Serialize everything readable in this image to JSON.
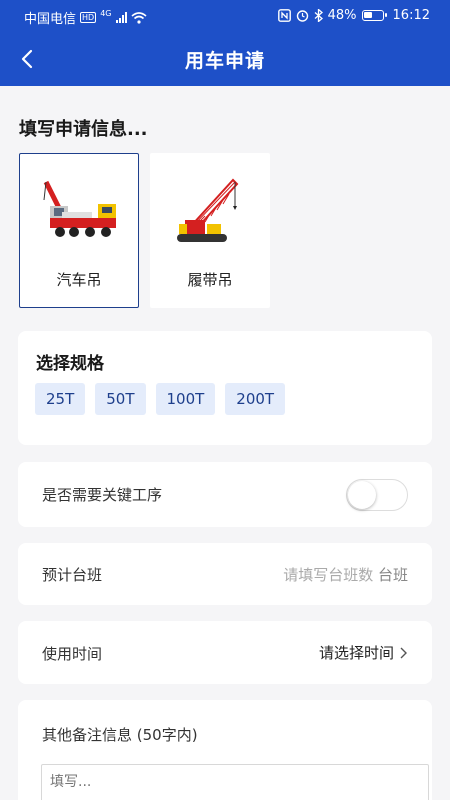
{
  "status_bar": {
    "carrier": "中国电信",
    "hd": "HD",
    "net": "4G",
    "battery": "48%",
    "time": "16:12"
  },
  "nav": {
    "title": "用车申请",
    "back_icon": "chevron-left-icon"
  },
  "form": {
    "section_title": "填写申请信息...",
    "vehicle_types": [
      {
        "label": "汽车吊",
        "selected": true
      },
      {
        "label": "履带吊",
        "selected": false
      }
    ],
    "spec": {
      "title": "选择规格",
      "options": [
        "25T",
        "50T",
        "100T",
        "200T"
      ]
    },
    "key_process": {
      "label": "是否需要关键工序",
      "enabled": false
    },
    "shifts": {
      "label": "预计台班",
      "placeholder": "请填写台班数",
      "unit": "台班"
    },
    "use_time": {
      "label": "使用时间",
      "value": "请选择时间"
    },
    "remarks": {
      "label": "其他备注信息 (50字内)",
      "placeholder": "填写..."
    }
  },
  "colors": {
    "primary": "#1e50c8",
    "chip_bg": "#e4ecfb",
    "chip_text": "#1e3f8c",
    "background": "#f5f5f7"
  }
}
